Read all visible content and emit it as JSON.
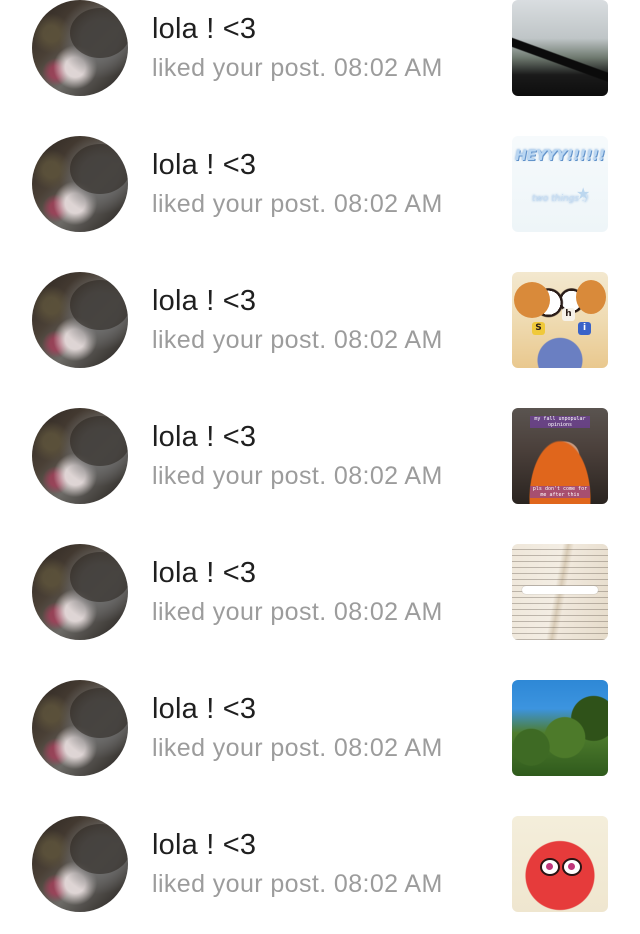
{
  "notifications": [
    {
      "name": "lola ! <3",
      "action": "liked your post.",
      "time": "08:02 AM",
      "thumb_icon": "car-windshield-photo"
    },
    {
      "name": "lola ! <3",
      "action": "liked your post.",
      "time": "08:02 AM",
      "thumb_icon": "heyyy-text-graphic",
      "thumb_text": "HEYYY!!!!!!",
      "thumb_subtext": "two things :)"
    },
    {
      "name": "lola ! <3",
      "action": "liked your post.",
      "time": "08:02 AM",
      "thumb_icon": "cartoon-scene",
      "thumb_tiles": [
        "S",
        "h",
        "i"
      ]
    },
    {
      "name": "lola ! <3",
      "action": "liked your post.",
      "time": "08:02 AM",
      "thumb_icon": "video-still",
      "thumb_caption_top": "my fall unpopular opinions",
      "thumb_caption_bottom": "pls don't come for me after this"
    },
    {
      "name": "lola ! <3",
      "action": "liked your post.",
      "time": "08:02 AM",
      "thumb_icon": "open-book-photo"
    },
    {
      "name": "lola ! <3",
      "action": "liked your post.",
      "time": "08:02 AM",
      "thumb_icon": "trees-sky-photo"
    },
    {
      "name": "lola ! <3",
      "action": "liked your post.",
      "time": "08:02 AM",
      "thumb_icon": "cartoon-character-graphic"
    }
  ],
  "colors": {
    "name_text": "#1f1f1f",
    "secondary_text": "#9c9c9c",
    "background": "#ffffff"
  }
}
